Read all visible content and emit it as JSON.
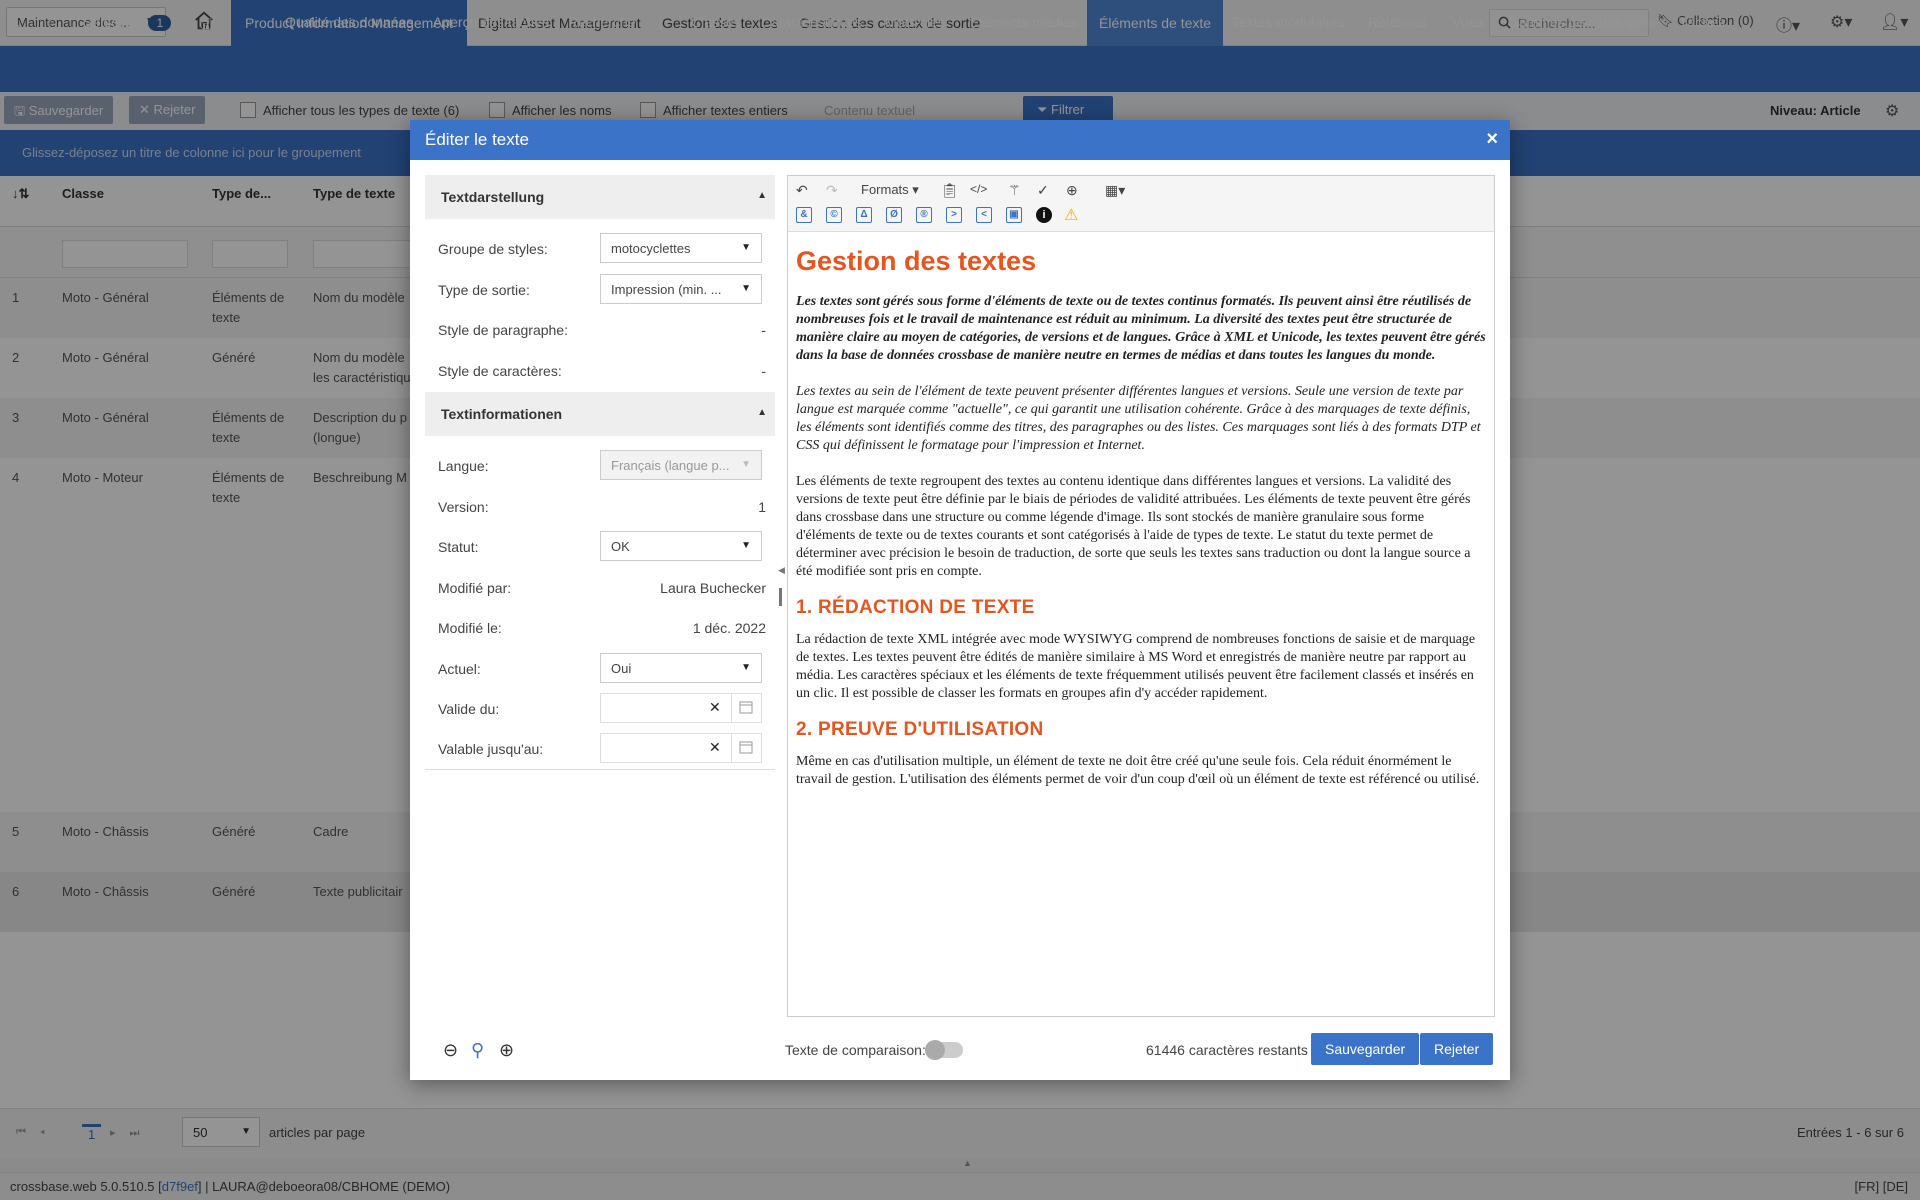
{
  "topbar": {
    "module_select": "Maintenance des ...",
    "tabs": [
      "Product Information Management",
      "Digital Asset Management",
      "Gestion des textes",
      "Gestion des canaux de sortie"
    ],
    "search_placeholder": "Rechercher...",
    "collection": "Collection (0)"
  },
  "navbar": {
    "selection_label": "Sélection",
    "selection_count": "1",
    "items": [
      "Qualité des données",
      "Aperçu des tâches",
      "Recherche",
      "|",
      "Classes",
      "Caractéristiques",
      "Mots-clés",
      "Éléments médias",
      "Éléments de texte",
      "Textes modulaires",
      "Relations",
      "Vues",
      "Gammes de catalogues",
      "Tâches"
    ]
  },
  "actionbar": {
    "save": "Sauvegarder",
    "reject": "Rejeter",
    "show_all_types": "Afficher tous les types de texte (6)",
    "show_names": "Afficher les noms",
    "show_full_texts": "Afficher textes entiers",
    "content_placeholder": "Contenu textuel",
    "filter": "Filtrer",
    "level": "Niveau: Article"
  },
  "groupbar": "Glissez-déposez un titre de colonne ici pour le groupement",
  "grid": {
    "headers": [
      "Classe",
      "Type de...",
      "Type de texte"
    ],
    "rows": [
      {
        "n": "1",
        "classe": "Moto - Général",
        "type": "Éléments de texte",
        "texte": "Nom du modèle"
      },
      {
        "n": "2",
        "classe": "Moto - Général",
        "type": "Généré",
        "texte": "Nom du modèle les caractéristiqu"
      },
      {
        "n": "3",
        "classe": "Moto - Général",
        "type": "Éléments de texte",
        "texte": "Description du p (longue)"
      },
      {
        "n": "4",
        "classe": "Moto - Moteur",
        "type": "Éléments de texte",
        "texte": "Beschreibung M"
      },
      {
        "n": "5",
        "classe": "Moto - Châssis",
        "type": "Généré",
        "texte": "Cadre"
      },
      {
        "n": "6",
        "classe": "Moto - Châssis",
        "type": "Généré",
        "texte": "Texte publicitair"
      }
    ]
  },
  "pager": {
    "page": "1",
    "per_page": "50",
    "per_page_label": "articles par page",
    "entries": "Entrées 1 - 6 sur 6"
  },
  "statusbar": {
    "prefix": "crossbase.web 5.0.510.5 [",
    "build": "d7f9ef",
    "suffix": "] | LAURA@deboeora08/CBHOME (DEMO)",
    "langs": "[FR] [DE]"
  },
  "modal": {
    "title": "Éditer le texte",
    "section1": "Textdarstellung",
    "section2": "Textinformationen",
    "fields": {
      "style_group_label": "Groupe de styles:",
      "style_group": "motocyclettes",
      "output_type_label": "Type de sortie:",
      "output_type": "Impression (min. ...",
      "paragraph_style_label": "Style de paragraphe:",
      "paragraph_style": "-",
      "char_style_label": "Style de caractères:",
      "char_style": "-",
      "language_label": "Langue:",
      "language": "Français (langue p...",
      "version_label": "Version:",
      "version": "1",
      "status_label": "Statut:",
      "status": "OK",
      "modified_by_label": "Modifié par:",
      "modified_by": "Laura Buchecker",
      "modified_on_label": "Modifié le:",
      "modified_on": "1 déc. 2022",
      "current_label": "Actuel:",
      "current": "Oui",
      "valid_from_label": "Valide du:",
      "valid_to_label": "Valable jusqu'au:"
    },
    "toolbar": {
      "formats": "Formats"
    },
    "content": {
      "title": "Gestion des textes",
      "p1": "Les textes sont gérés sous forme d'éléments de texte ou de textes continus formatés. Ils peuvent ainsi être réutilisés de nombreuses fois et le travail de maintenance est réduit au minimum. La diversité des textes peut être structurée de manière claire au moyen de catégories, de versions et de langues. Grâce à XML et Unicode, les textes peuvent être gérés dans la base de données crossbase de manière neutre en termes de médias et dans toutes les langues du monde.",
      "p2": "Les textes au sein de l'élément de texte peuvent présenter différentes langues et versions. Seule une version de texte par langue est marquée comme \"actuelle\", ce qui garantit une utilisation cohérente. Grâce à des marquages de texte définis, les éléments sont identifiés comme des titres, des paragraphes ou des listes. Ces marquages sont liés à des formats DTP et CSS qui définissent le formatage pour l'impression et Internet.",
      "p3": "Les éléments de texte regroupent des textes au contenu identique dans différentes langues et versions. La validité des versions de texte peut être définie par le biais de périodes de validité attribuées. Les éléments de texte peuvent être gérés dans crossbase dans une structure ou comme légende d'image. Ils sont stockés de manière granulaire sous forme d'éléments de texte ou de textes courants et sont catégorisés à l'aide de types de texte. Le statut du texte permet de déterminer avec précision le besoin de traduction, de sorte que seuls les textes sans traduction ou dont la langue source a été modifiée sont pris en compte.",
      "h2a": "1.  RÉDACTION DE TEXTE",
      "p4": "La rédaction de texte XML intégrée avec mode WYSIWYG comprend de nombreuses fonctions de saisie et de marquage de textes. Les textes peuvent être édités de manière similaire à MS Word et enregistrés de manière neutre par rapport au média. Les caractères spéciaux et les éléments de texte fréquemment utilisés peuvent être facilement classés et insérés en un clic. Il est possible de classer les formats en groupes afin d'y accéder rapidement.",
      "h2b": "2.  PREUVE D'UTILISATION",
      "p5": "Même en cas d'utilisation multiple, un élément de texte ne doit être créé qu'une seule fois. Cela réduit énormément le travail de gestion. L'utilisation des éléments permet de voir d'un coup d'œil où un élément de texte est référencé ou utilisé."
    },
    "footer": {
      "compare_label": "Texte de comparaison:",
      "chars_left": "61446 caractères restants",
      "save": "Sauvegarder",
      "reject": "Rejeter"
    }
  }
}
